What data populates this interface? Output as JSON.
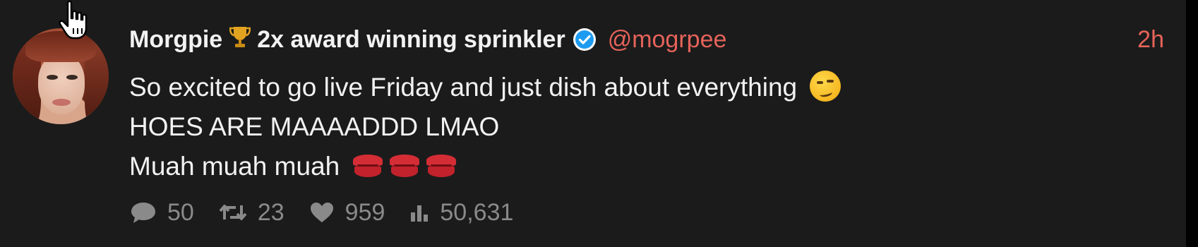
{
  "post": {
    "display_name": "Morgpie",
    "name_badge_icon": "trophy-icon",
    "name_suffix": "2x award winning sprinkler",
    "verified_icon": "verified-badge-icon",
    "handle": "@mogrpee",
    "time": "2h",
    "lines": [
      "So excited to go live Friday and just dish about everything",
      "HOES ARE MAAAADDD LMAO",
      "Muah muah muah"
    ],
    "line1_emoji": "smirking-face-emoji",
    "line3_emoji": [
      "kiss-mark-emoji",
      "kiss-mark-emoji",
      "kiss-mark-emoji"
    ]
  },
  "stats": {
    "replies": "50",
    "reposts": "23",
    "likes": "959",
    "views": "50,631"
  },
  "colors": {
    "background": "#1b1b1b",
    "text": "#f2f2f2",
    "accent": "#e5635a",
    "muted": "#8a8a8a",
    "verified": "#1d9bf0"
  }
}
